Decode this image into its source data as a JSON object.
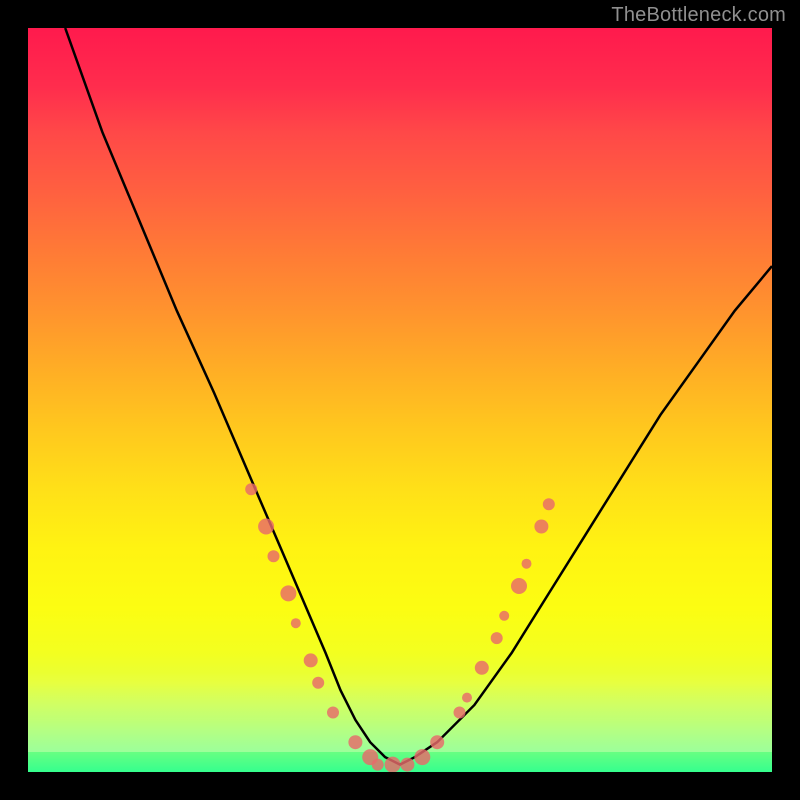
{
  "watermark": "TheBottleneck.com",
  "colors": {
    "frame": "#000000",
    "curve": "#000000",
    "marker_fill": "#e86a6a",
    "marker_stroke": "#cc5555",
    "gradient_stops": [
      "#ff1a4d",
      "#ff4848",
      "#ff7a36",
      "#ffae25",
      "#ffe018",
      "#fcfd12",
      "#e6ff3a",
      "#9eff6e",
      "#35ff8e"
    ]
  },
  "chart_data": {
    "type": "line",
    "title": "",
    "xlabel": "",
    "ylabel": "",
    "xlim": [
      0,
      100
    ],
    "ylim": [
      0,
      100
    ],
    "notes": "V-shaped bottleneck curve. Background is a red→yellow→green vertical gradient. Pink dots cluster near the curve's trough (low region) on both flanks.",
    "series": [
      {
        "name": "bottleneck-curve",
        "x": [
          5,
          10,
          15,
          20,
          25,
          28,
          31,
          34,
          37,
          40,
          42,
          44,
          46,
          48,
          50,
          52,
          55,
          60,
          65,
          70,
          75,
          80,
          85,
          90,
          95,
          100
        ],
        "y": [
          100,
          86,
          74,
          62,
          51,
          44,
          37,
          30,
          23,
          16,
          11,
          7,
          4,
          2,
          1,
          2,
          4,
          9,
          16,
          24,
          32,
          40,
          48,
          55,
          62,
          68
        ]
      }
    ],
    "markers": [
      {
        "x": 30,
        "y": 38,
        "r": 6
      },
      {
        "x": 32,
        "y": 33,
        "r": 8
      },
      {
        "x": 33,
        "y": 29,
        "r": 6
      },
      {
        "x": 35,
        "y": 24,
        "r": 8
      },
      {
        "x": 36,
        "y": 20,
        "r": 5
      },
      {
        "x": 38,
        "y": 15,
        "r": 7
      },
      {
        "x": 39,
        "y": 12,
        "r": 6
      },
      {
        "x": 41,
        "y": 8,
        "r": 6
      },
      {
        "x": 44,
        "y": 4,
        "r": 7
      },
      {
        "x": 46,
        "y": 2,
        "r": 8
      },
      {
        "x": 47,
        "y": 1,
        "r": 6
      },
      {
        "x": 49,
        "y": 1,
        "r": 8
      },
      {
        "x": 51,
        "y": 1,
        "r": 7
      },
      {
        "x": 53,
        "y": 2,
        "r": 8
      },
      {
        "x": 55,
        "y": 4,
        "r": 7
      },
      {
        "x": 58,
        "y": 8,
        "r": 6
      },
      {
        "x": 59,
        "y": 10,
        "r": 5
      },
      {
        "x": 61,
        "y": 14,
        "r": 7
      },
      {
        "x": 63,
        "y": 18,
        "r": 6
      },
      {
        "x": 64,
        "y": 21,
        "r": 5
      },
      {
        "x": 66,
        "y": 25,
        "r": 8
      },
      {
        "x": 67,
        "y": 28,
        "r": 5
      },
      {
        "x": 69,
        "y": 33,
        "r": 7
      },
      {
        "x": 70,
        "y": 36,
        "r": 6
      }
    ]
  }
}
